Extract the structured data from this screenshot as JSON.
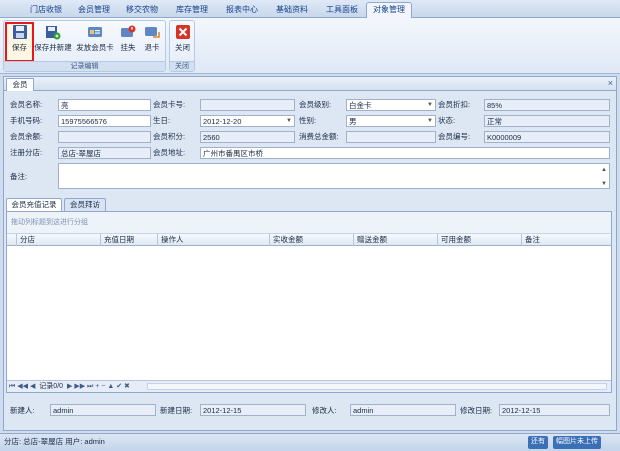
{
  "menu": {
    "tabs": [
      {
        "label": "门店收银",
        "active": false
      },
      {
        "label": "会员管理",
        "active": false
      },
      {
        "label": "移交农物",
        "active": false
      },
      {
        "label": "库存管理",
        "active": false
      },
      {
        "label": "报表中心",
        "active": false
      },
      {
        "label": "基础资料",
        "active": false
      },
      {
        "label": "工具面板",
        "active": false
      },
      {
        "label": "对象管理",
        "active": true
      }
    ]
  },
  "ribbon": {
    "groups": [
      {
        "label": "记录编辑",
        "buttons": [
          {
            "label": "保存",
            "icon": "floppy-disk-icon",
            "selected": true
          },
          {
            "label": "保存并新建",
            "icon": "save-new-icon"
          },
          {
            "label": "发放会员卡",
            "icon": "member-card-icon"
          },
          {
            "label": "挂失",
            "icon": "report-loss-icon"
          },
          {
            "label": "退卡",
            "icon": "return-card-icon"
          }
        ]
      },
      {
        "label": "关闭",
        "buttons": [
          {
            "label": "关闭",
            "icon": "close-red-x-icon"
          }
        ]
      }
    ]
  },
  "panel": {
    "tab_label": "会员",
    "close_glyph": "×"
  },
  "form": {
    "member_name": {
      "label": "会员名称:",
      "value": "亮"
    },
    "card_no": {
      "label": "会员卡号:",
      "value": ""
    },
    "level": {
      "label": "会员级别:",
      "value": "白金卡"
    },
    "discount": {
      "label": "会员折扣:",
      "value": "85%"
    },
    "phone": {
      "label": "手机号码:",
      "value": "15975566576"
    },
    "birthday": {
      "label": "生日:",
      "value": "2012-12-20"
    },
    "gender": {
      "label": "性别:",
      "value": "男"
    },
    "state": {
      "label": "状态:",
      "value": "正常"
    },
    "balance": {
      "label": "会员余额:",
      "value": ""
    },
    "points": {
      "label": "会员积分:",
      "value": "2560"
    },
    "total_spent": {
      "label": "消费总金额:",
      "value": ""
    },
    "member_no": {
      "label": "会员编号:",
      "value": "K0000009"
    },
    "branch": {
      "label": "注册分店:",
      "value": "总店-翠屋店"
    },
    "address": {
      "label": "会员地址:",
      "value": "广州市番禺区市桥"
    },
    "note": {
      "label": "备注:",
      "value": ""
    }
  },
  "subtabs": [
    {
      "label": "会员充值记录",
      "active": true
    },
    {
      "label": "会员拜访",
      "active": false
    }
  ],
  "grid": {
    "group_hint": "拖动列标题到这进行分组",
    "columns": [
      "分店",
      "充值日期",
      "操作人",
      "实收金额",
      "赠送金额",
      "可用金额",
      "备注"
    ],
    "nav_glyphs": "⏮ ◀◀ ◀",
    "record_text": "记录0/0",
    "nav_glyphs_after": "▶ ▶▶ ⏭ + − ▲ ✔ ✖"
  },
  "footer": {
    "creator": {
      "label": "新建人:",
      "value": "admin"
    },
    "create_date": {
      "label": "新建日期:",
      "value": "2012-12-15"
    },
    "modifier": {
      "label": "修改人:",
      "value": "admin"
    },
    "modify_date": {
      "label": "修改日期:",
      "value": "2012-12-15"
    }
  },
  "status": {
    "text": "分店: 总店-翠屋店  用户: admin",
    "badge1": "还有",
    "badge2": "幅图片未上传"
  }
}
